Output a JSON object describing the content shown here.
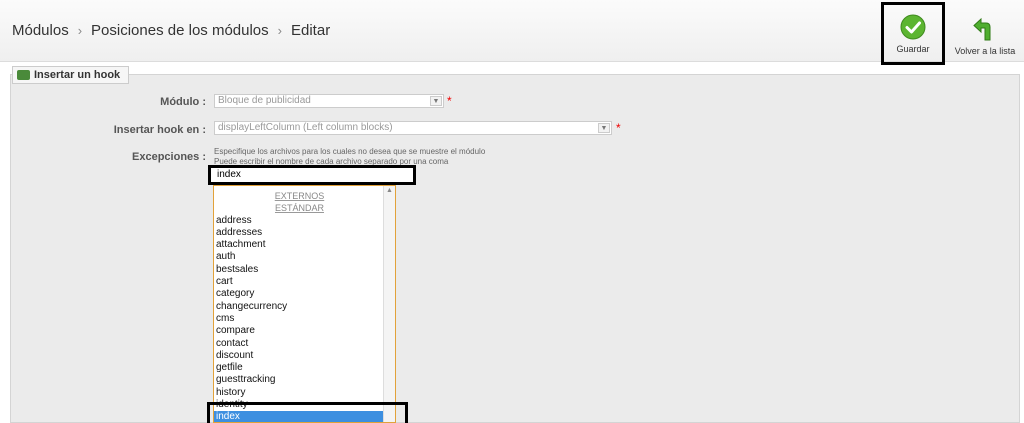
{
  "header": {
    "breadcrumb": [
      "Módulos",
      "Posiciones de los módulos",
      "Editar"
    ],
    "separator": "›",
    "save_label": "Guardar",
    "back_label": "Volver a la lista"
  },
  "form": {
    "legend": "Insertar un hook",
    "module": {
      "label": "Módulo :",
      "value": "Bloque de publicidad"
    },
    "hook": {
      "label": "Insertar hook en :",
      "value": "displayLeftColumn (Left column blocks)"
    },
    "exceptions": {
      "label": "Excepciones :",
      "help1": "Especifique los archivos para los cuales no desea que se muestre el módulo",
      "help2": "Puede escribir el nombre de cada archivo separado por una coma",
      "input_value": "index",
      "groups": [
        "EXTERNOS",
        "ESTÁNDAR"
      ],
      "options": [
        "address",
        "addresses",
        "attachment",
        "auth",
        "bestsales",
        "cart",
        "category",
        "changecurrency",
        "cms",
        "compare",
        "contact",
        "discount",
        "getfile",
        "guesttracking",
        "history",
        "identity",
        "index"
      ],
      "selected": "index"
    },
    "required_mark": "*"
  },
  "colors": {
    "accent": "#3d8fe0",
    "save_green": "#5cb531",
    "required": "#e00000"
  }
}
